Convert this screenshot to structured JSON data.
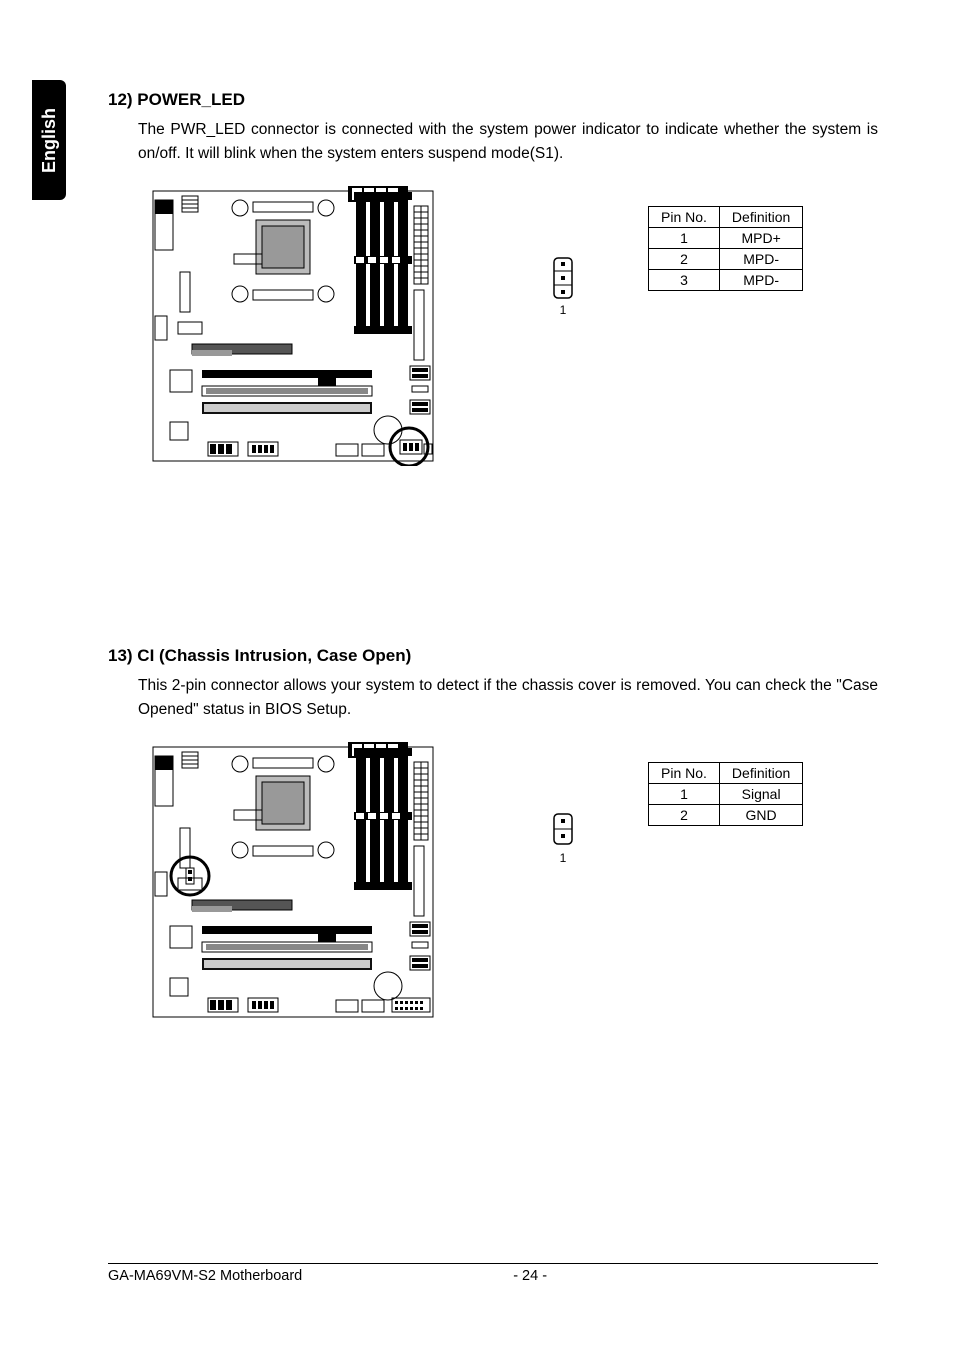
{
  "language_tab": "English",
  "section12": {
    "heading": "12)  POWER_LED",
    "paragraph": "The PWR_LED connector is connected with the system power indicator to indicate whether the system is on/off. It will blink when the system enters suspend mode(S1).",
    "connector_pin1": "1",
    "table": {
      "head": {
        "pin": "Pin No.",
        "def": "Definition"
      },
      "rows": [
        {
          "pin": "1",
          "def": "MPD+"
        },
        {
          "pin": "2",
          "def": "MPD-"
        },
        {
          "pin": "3",
          "def": "MPD-"
        }
      ]
    }
  },
  "section13": {
    "heading": "13)  CI (Chassis Intrusion, Case Open)",
    "paragraph": "This 2-pin connector allows your system to detect if the chassis cover is removed. You can check the \"Case Opened\"  status in BIOS Setup.",
    "connector_pin1": "1",
    "table": {
      "head": {
        "pin": "Pin No.",
        "def": "Definition"
      },
      "rows": [
        {
          "pin": "1",
          "def": "Signal"
        },
        {
          "pin": "2",
          "def": "GND"
        }
      ]
    }
  },
  "footer": {
    "model": "GA-MA69VM-S2 Motherboard",
    "page": "- 24 -"
  }
}
